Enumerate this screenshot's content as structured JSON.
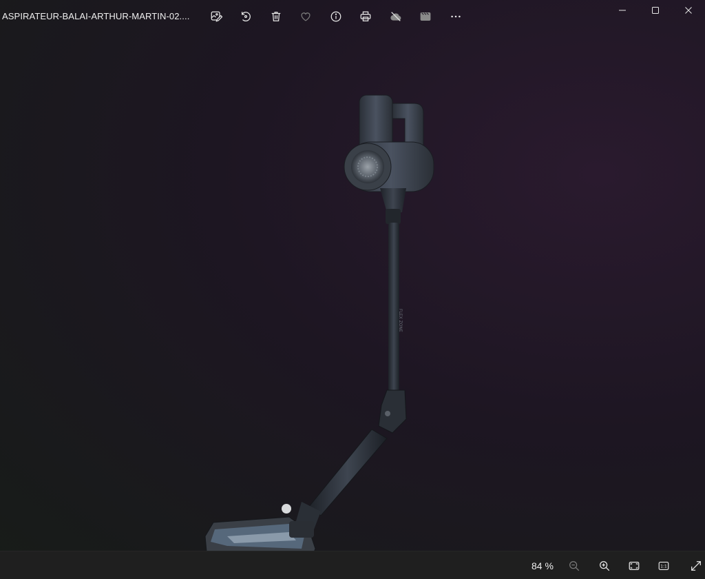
{
  "window": {
    "title": "ASPIRATEUR-BALAI-ARTHUR-MARTIN-02....",
    "controls": [
      "minimize",
      "maximize",
      "close"
    ]
  },
  "toolbar": {
    "items": [
      {
        "name": "edit-image",
        "icon": "edit-image-icon"
      },
      {
        "name": "rotate",
        "icon": "rotate-icon"
      },
      {
        "name": "delete",
        "icon": "trash-icon"
      },
      {
        "name": "favorite",
        "icon": "heart-icon"
      },
      {
        "name": "file-info",
        "icon": "info-icon"
      },
      {
        "name": "print",
        "icon": "printer-icon"
      },
      {
        "name": "cloud",
        "icon": "cloud-off-icon"
      },
      {
        "name": "slideshow",
        "icon": "slideshow-icon"
      },
      {
        "name": "more",
        "icon": "more-icon"
      }
    ]
  },
  "statusbar": {
    "zoom": "84 %",
    "actual_size_label": "1:1"
  },
  "colors": {
    "background_dark": "#1d1622",
    "statusbar": "#1f1f1f",
    "icon": "#e8e8e8",
    "icon_disabled": "#7a7a7a"
  }
}
